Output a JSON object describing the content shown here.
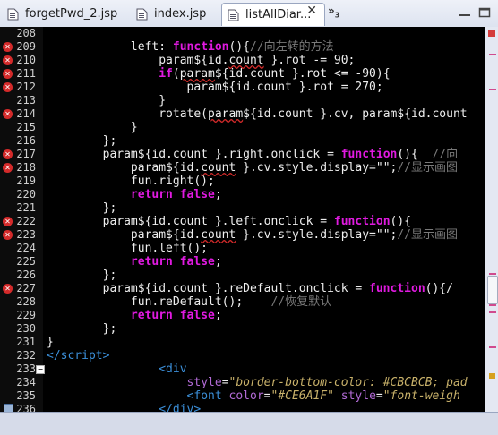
{
  "tabs": [
    {
      "label": "forgetPwd_2.jsp",
      "icon": "jsp-file-icon",
      "active": false
    },
    {
      "label": "index.jsp",
      "icon": "jsp-file-icon",
      "active": false
    },
    {
      "label": "listAllDiar...",
      "icon": "jsp-file-icon",
      "active": true
    }
  ],
  "close_symbol": "✕",
  "overflow": {
    "label": "»",
    "count": "3"
  },
  "colors": {
    "error": "#d42a2a",
    "keyword": "#e01ae0",
    "tag": "#3b8fd9",
    "comment": "#7a7a7a",
    "ruler_mark": "#d04b8e"
  },
  "lines": [
    {
      "n": "208",
      "code": ""
    },
    {
      "n": "209",
      "err": true,
      "html": "            left: <span class=\"kw\">function</span>(){<span class=\"cm\">//向左转的方法</span>"
    },
    {
      "n": "210",
      "err": true,
      "html": "                param${id.<span class=\"err\">count</span> }.rot -= 90;"
    },
    {
      "n": "211",
      "err": true,
      "html": "                <span class=\"kw\">if</span>(<span class=\"err\">param</span>${id.count }.rot &lt;= -90){"
    },
    {
      "n": "212",
      "err": true,
      "html": "                    param${id.count }.rot = 270;"
    },
    {
      "n": "213",
      "code": "                }"
    },
    {
      "n": "214",
      "err": true,
      "html": "                rotate(<span class=\"err\">param</span>${id.count }.cv, param${id.count"
    },
    {
      "n": "215",
      "code": "            }"
    },
    {
      "n": "216",
      "code": "        };"
    },
    {
      "n": "217",
      "err": true,
      "html": "        param${id.count }.right.onclick = <span class=\"kw\">function</span>(){  <span class=\"cm\">//向</span>"
    },
    {
      "n": "218",
      "err": true,
      "html": "            param${id.<span class=\"err\">count</span> }.cv.style.display=<span class=\"str\">\"\"</span>;<span class=\"cm\">//显示画图</span>"
    },
    {
      "n": "219",
      "code": "            fun.right();"
    },
    {
      "n": "220",
      "html": "            <span class=\"kw\">return</span> <span class=\"kw\">false</span>;"
    },
    {
      "n": "221",
      "code": "        };"
    },
    {
      "n": "222",
      "err": true,
      "html": "        param${id.count }.left.onclick = <span class=\"kw\">function</span>(){"
    },
    {
      "n": "223",
      "err": true,
      "html": "            param${id.<span class=\"err\">count</span> }.cv.style.display=<span class=\"str\">\"\"</span>;<span class=\"cm\">//显示画图</span>"
    },
    {
      "n": "224",
      "code": "            fun.left();"
    },
    {
      "n": "225",
      "html": "            <span class=\"kw\">return</span> <span class=\"kw\">false</span>;"
    },
    {
      "n": "226",
      "code": "        };"
    },
    {
      "n": "227",
      "err": true,
      "html": "        param${id.count }.reDefault.onclick = <span class=\"kw\">function</span>(){/"
    },
    {
      "n": "228",
      "html": "            fun.reDefault();    <span class=\"cm\">//恢复默认</span>"
    },
    {
      "n": "229",
      "html": "            <span class=\"kw\">return</span> <span class=\"kw\">false</span>;"
    },
    {
      "n": "230",
      "code": "        };"
    },
    {
      "n": "231",
      "code": "}"
    },
    {
      "n": "232",
      "html": "<span class=\"tag\">&lt;/script&gt;</span>"
    },
    {
      "n": "233",
      "fold": true,
      "html": "                <span class=\"tag\">&lt;div</span>"
    },
    {
      "n": "234",
      "html": "                    <span class=\"attr\">style</span>=<span class=\"aval\">\"border-bottom-color: #CBCBCB; pad</span>"
    },
    {
      "n": "235",
      "html": "                    <span class=\"tag\">&lt;font</span> <span class=\"attr\">color</span>=<span class=\"aval\">\"#CE6A1F\"</span> <span class=\"attr\">style</span>=<span class=\"aval\">\"font-weigh</span>"
    },
    {
      "n": "236",
      "bookmark": true,
      "html": "                <span class=\"tag\">&lt;/div&gt;</span>"
    }
  ],
  "ruler_marks": [
    {
      "pos": 0.07,
      "kind": "e"
    },
    {
      "pos": 0.16,
      "kind": "e"
    },
    {
      "pos": 0.64,
      "kind": "e"
    },
    {
      "pos": 0.66,
      "kind": "e"
    },
    {
      "pos": 0.68,
      "kind": "e"
    },
    {
      "pos": 0.7,
      "kind": "e"
    },
    {
      "pos": 0.72,
      "kind": "e"
    },
    {
      "pos": 0.74,
      "kind": "e"
    },
    {
      "pos": 0.83,
      "kind": "e"
    },
    {
      "pos": 0.9,
      "kind": "y"
    }
  ]
}
